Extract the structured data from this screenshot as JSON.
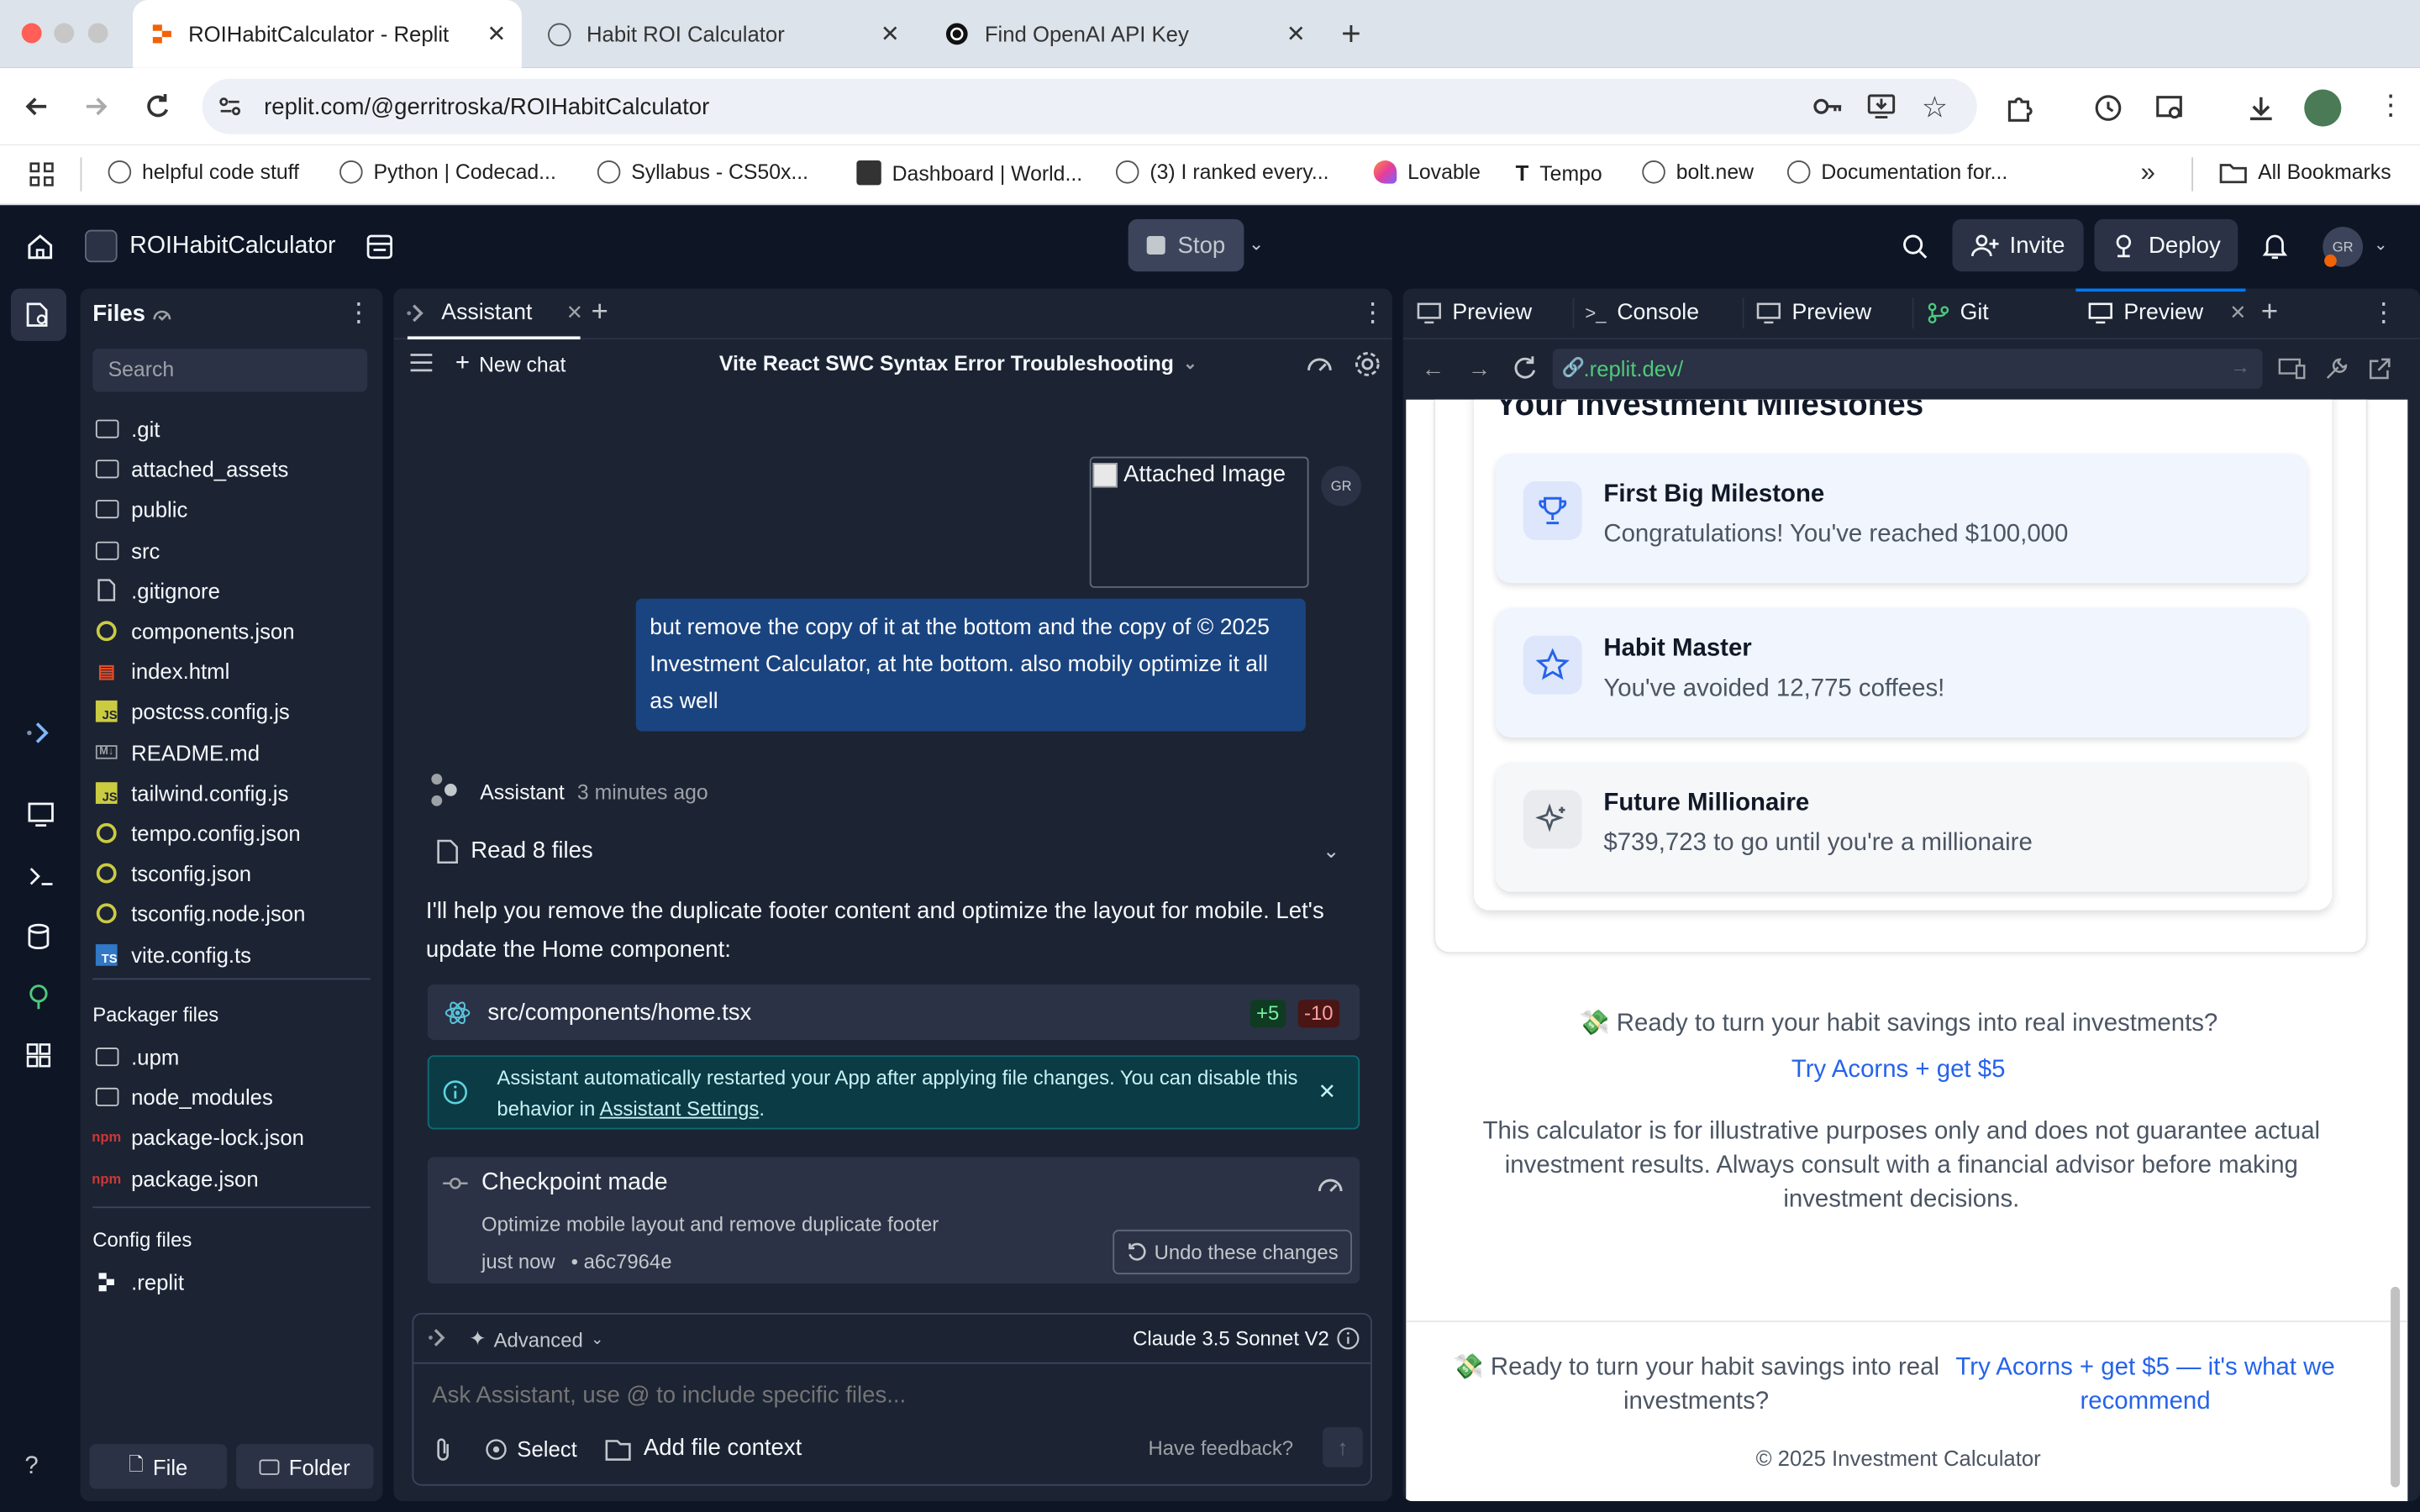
{
  "browser": {
    "tabs": [
      {
        "label": "ROIHabitCalculator - Replit",
        "active": true
      },
      {
        "label": "Habit ROI Calculator",
        "active": false
      },
      {
        "label": "Find OpenAI API Key",
        "active": false
      }
    ],
    "url": "replit.com/@gerritroska/ROIHabitCalculator",
    "bookmarks": [
      "helpful code stuff",
      "Python | Codecad...",
      "Syllabus - CS50x...",
      "Dashboard | World...",
      "(3) I ranked every...",
      "Lovable",
      "Tempo",
      "bolt.new",
      "Documentation for..."
    ],
    "all_bookmarks": "All Bookmarks"
  },
  "header": {
    "project": "ROIHabitCalculator",
    "stop": "Stop",
    "invite": "Invite",
    "deploy": "Deploy",
    "avatar": "GR"
  },
  "files": {
    "title": "Files",
    "search_placeholder": "Search",
    "items": [
      {
        "name": ".git",
        "icon": "folder"
      },
      {
        "name": "attached_assets",
        "icon": "folder"
      },
      {
        "name": "public",
        "icon": "folder"
      },
      {
        "name": "src",
        "icon": "folder"
      },
      {
        "name": ".gitignore",
        "icon": "file"
      },
      {
        "name": "components.json",
        "icon": "json"
      },
      {
        "name": "index.html",
        "icon": "html"
      },
      {
        "name": "postcss.config.js",
        "icon": "js"
      },
      {
        "name": "README.md",
        "icon": "md"
      },
      {
        "name": "tailwind.config.js",
        "icon": "js"
      },
      {
        "name": "tempo.config.json",
        "icon": "json"
      },
      {
        "name": "tsconfig.json",
        "icon": "json"
      },
      {
        "name": "tsconfig.node.json",
        "icon": "json"
      },
      {
        "name": "vite.config.ts",
        "icon": "ts"
      }
    ],
    "packager_title": "Packager files",
    "packager_items": [
      {
        "name": ".upm",
        "icon": "folder"
      },
      {
        "name": "node_modules",
        "icon": "folder"
      },
      {
        "name": "package-lock.json",
        "icon": "npm"
      },
      {
        "name": "package.json",
        "icon": "npm"
      }
    ],
    "config_title": "Config files",
    "config_items": [
      {
        "name": ".replit",
        "icon": "replit"
      }
    ],
    "file_button": "File",
    "folder_button": "Folder"
  },
  "assistant": {
    "tab": "Assistant",
    "new_chat": "New chat",
    "chat_title": "Vite React SWC Syntax Error Troubleshooting",
    "attached_image": "Attached Image",
    "user_avatar": "GR",
    "user_message": "but remove the copy of it at the bottom and the copy of © 2025 Investment Calculator, at hte bottom. also mobily optimize it all as well",
    "sender": "Assistant",
    "time": "3 minutes ago",
    "read_files": "Read 8 files",
    "reply": "I'll help you remove the duplicate footer content and optimize the layout for mobile. Let's update the Home component:",
    "file_path": "src/components/home.tsx",
    "added": "+5",
    "removed": "-10",
    "notice_text": "Assistant automatically restarted your App after applying file changes. You can disable this behavior in ",
    "notice_link": "Assistant Settings",
    "notice_end": ".",
    "checkpoint_title": "Checkpoint made",
    "checkpoint_desc": "Optimize mobile layout and remove duplicate footer",
    "checkpoint_time": "just now",
    "checkpoint_hash": "• a6c7964e",
    "undo": "Undo these changes",
    "mode": "Advanced",
    "model": "Claude 3.5 Sonnet V2",
    "input_placeholder": "Ask Assistant, use @ to include specific files...",
    "select": "Select",
    "add_context": "Add file context",
    "feedback": "Have feedback?"
  },
  "preview": {
    "tabs": [
      "Preview",
      "Console",
      "Preview",
      "Git",
      "Preview"
    ],
    "url": ".replit.dev/",
    "milestones_heading": "Your Investment Milestones",
    "milestones": [
      {
        "title": "First Big Milestone",
        "subtitle": "Congratulations! You've reached $100,000",
        "icon": "trophy-icon"
      },
      {
        "title": "Habit Master",
        "subtitle": "You've avoided 12,775 coffees!",
        "icon": "star-icon"
      },
      {
        "title": "Future Millionaire",
        "subtitle": "$739,723 to go until you're a millionaire",
        "icon": "sparkles-icon"
      }
    ],
    "cta_emoji": "💸",
    "cta_text": "Ready to turn your habit savings into real investments?",
    "cta_link": "Try Acorns + get $5",
    "disclaimer": "This calculator is for illustrative purposes only and does not guarantee actual investment results. Always consult with a financial advisor before making investment decisions.",
    "footer_text": "Ready to turn your habit savings into real investments?",
    "footer_link": "Try Acorns + get $5 — it's what we recommend",
    "copyright": "© 2025 Investment Calculator"
  }
}
